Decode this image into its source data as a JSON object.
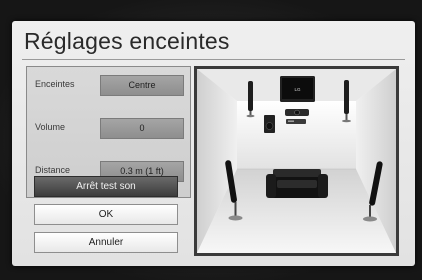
{
  "dialog": {
    "title": "Réglages enceintes"
  },
  "settings": {
    "rows": [
      {
        "label": "Enceintes",
        "value": "Centre"
      },
      {
        "label": "Volume",
        "value": "0"
      },
      {
        "label": "Distance",
        "value": "0.3 m (1 ft)"
      }
    ]
  },
  "buttons": {
    "test_sound": "Arrêt test son",
    "ok": "OK",
    "cancel": "Annuler"
  },
  "preview": {
    "tv_logo": "LG"
  }
}
